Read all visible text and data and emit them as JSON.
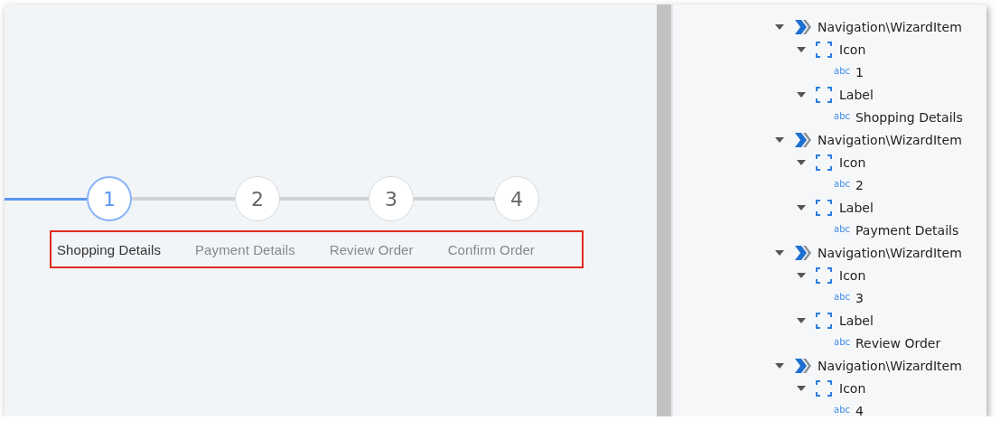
{
  "wizard": {
    "steps": [
      {
        "number": "1",
        "label": "Shopping Details",
        "selected": true
      },
      {
        "number": "2",
        "label": "Payment Details",
        "selected": false
      },
      {
        "number": "3",
        "label": "Review Order",
        "selected": false
      },
      {
        "number": "4",
        "label": "Confirm Order",
        "selected": false
      }
    ]
  },
  "tree": [
    {
      "kind": "widget",
      "label": "Navigation\\WizardItem",
      "expanded": true,
      "children": [
        {
          "kind": "placeholder",
          "label": "Icon",
          "expanded": true,
          "children": [
            {
              "kind": "expression",
              "badge": "abc",
              "label": "1"
            }
          ]
        },
        {
          "kind": "placeholder",
          "label": "Label",
          "expanded": true,
          "children": [
            {
              "kind": "expression",
              "badge": "abc",
              "label": "Shopping Details"
            }
          ]
        }
      ]
    },
    {
      "kind": "widget",
      "label": "Navigation\\WizardItem",
      "expanded": true,
      "children": [
        {
          "kind": "placeholder",
          "label": "Icon",
          "expanded": true,
          "children": [
            {
              "kind": "expression",
              "badge": "abc",
              "label": "2"
            }
          ]
        },
        {
          "kind": "placeholder",
          "label": "Label",
          "expanded": true,
          "children": [
            {
              "kind": "expression",
              "badge": "abc",
              "label": "Payment Details"
            }
          ]
        }
      ]
    },
    {
      "kind": "widget",
      "label": "Navigation\\WizardItem",
      "expanded": true,
      "children": [
        {
          "kind": "placeholder",
          "label": "Icon",
          "expanded": true,
          "children": [
            {
              "kind": "expression",
              "badge": "abc",
              "label": "3"
            }
          ]
        },
        {
          "kind": "placeholder",
          "label": "Label",
          "expanded": true,
          "children": [
            {
              "kind": "expression",
              "badge": "abc",
              "label": "Review Order"
            }
          ]
        }
      ]
    },
    {
      "kind": "widget",
      "label": "Navigation\\WizardItem",
      "expanded": true,
      "children": [
        {
          "kind": "placeholder",
          "label": "Icon",
          "expanded": true,
          "children": [
            {
              "kind": "expression",
              "badge": "abc",
              "label": "4"
            }
          ]
        }
      ]
    }
  ]
}
